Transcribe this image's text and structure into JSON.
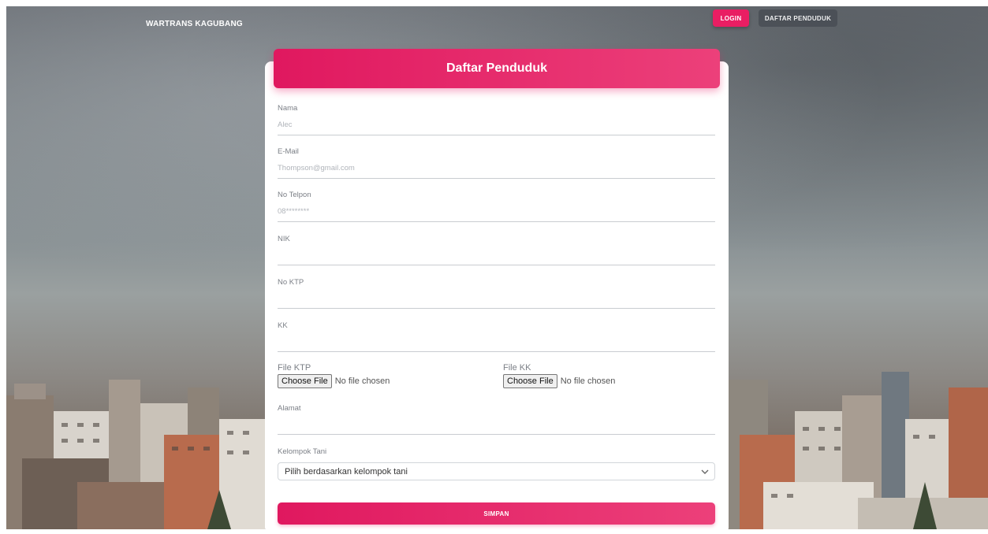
{
  "navbar": {
    "brand": "WARTRANS KAGUBANG",
    "login_label": "LOGIN",
    "register_label": "DAFTAR PENDUDUK"
  },
  "form": {
    "title": "Daftar Penduduk",
    "fields": [
      {
        "label": "Nama",
        "placeholder": "Alec"
      },
      {
        "label": "E-Mail",
        "placeholder": "Thompson@gmail.com"
      },
      {
        "label": "No Telpon",
        "placeholder": "08********"
      },
      {
        "label": "NIK",
        "placeholder": ""
      },
      {
        "label": "No KTP",
        "placeholder": ""
      },
      {
        "label": "KK",
        "placeholder": ""
      }
    ],
    "file_ktp": {
      "label": "File KTP",
      "button": "Choose File",
      "status": "No file chosen"
    },
    "file_kk": {
      "label": "File KK",
      "button": "Choose File",
      "status": "No file chosen"
    },
    "alamat": {
      "label": "Alamat",
      "placeholder": ""
    },
    "kelompok_tani": {
      "label": "Kelompok Tani",
      "selected": "Pilih berdasarkan kelompok tani"
    },
    "submit_label": "SIMPAN"
  },
  "colors": {
    "accent": "#e91e63",
    "secondary_button": "#4a4f56"
  }
}
